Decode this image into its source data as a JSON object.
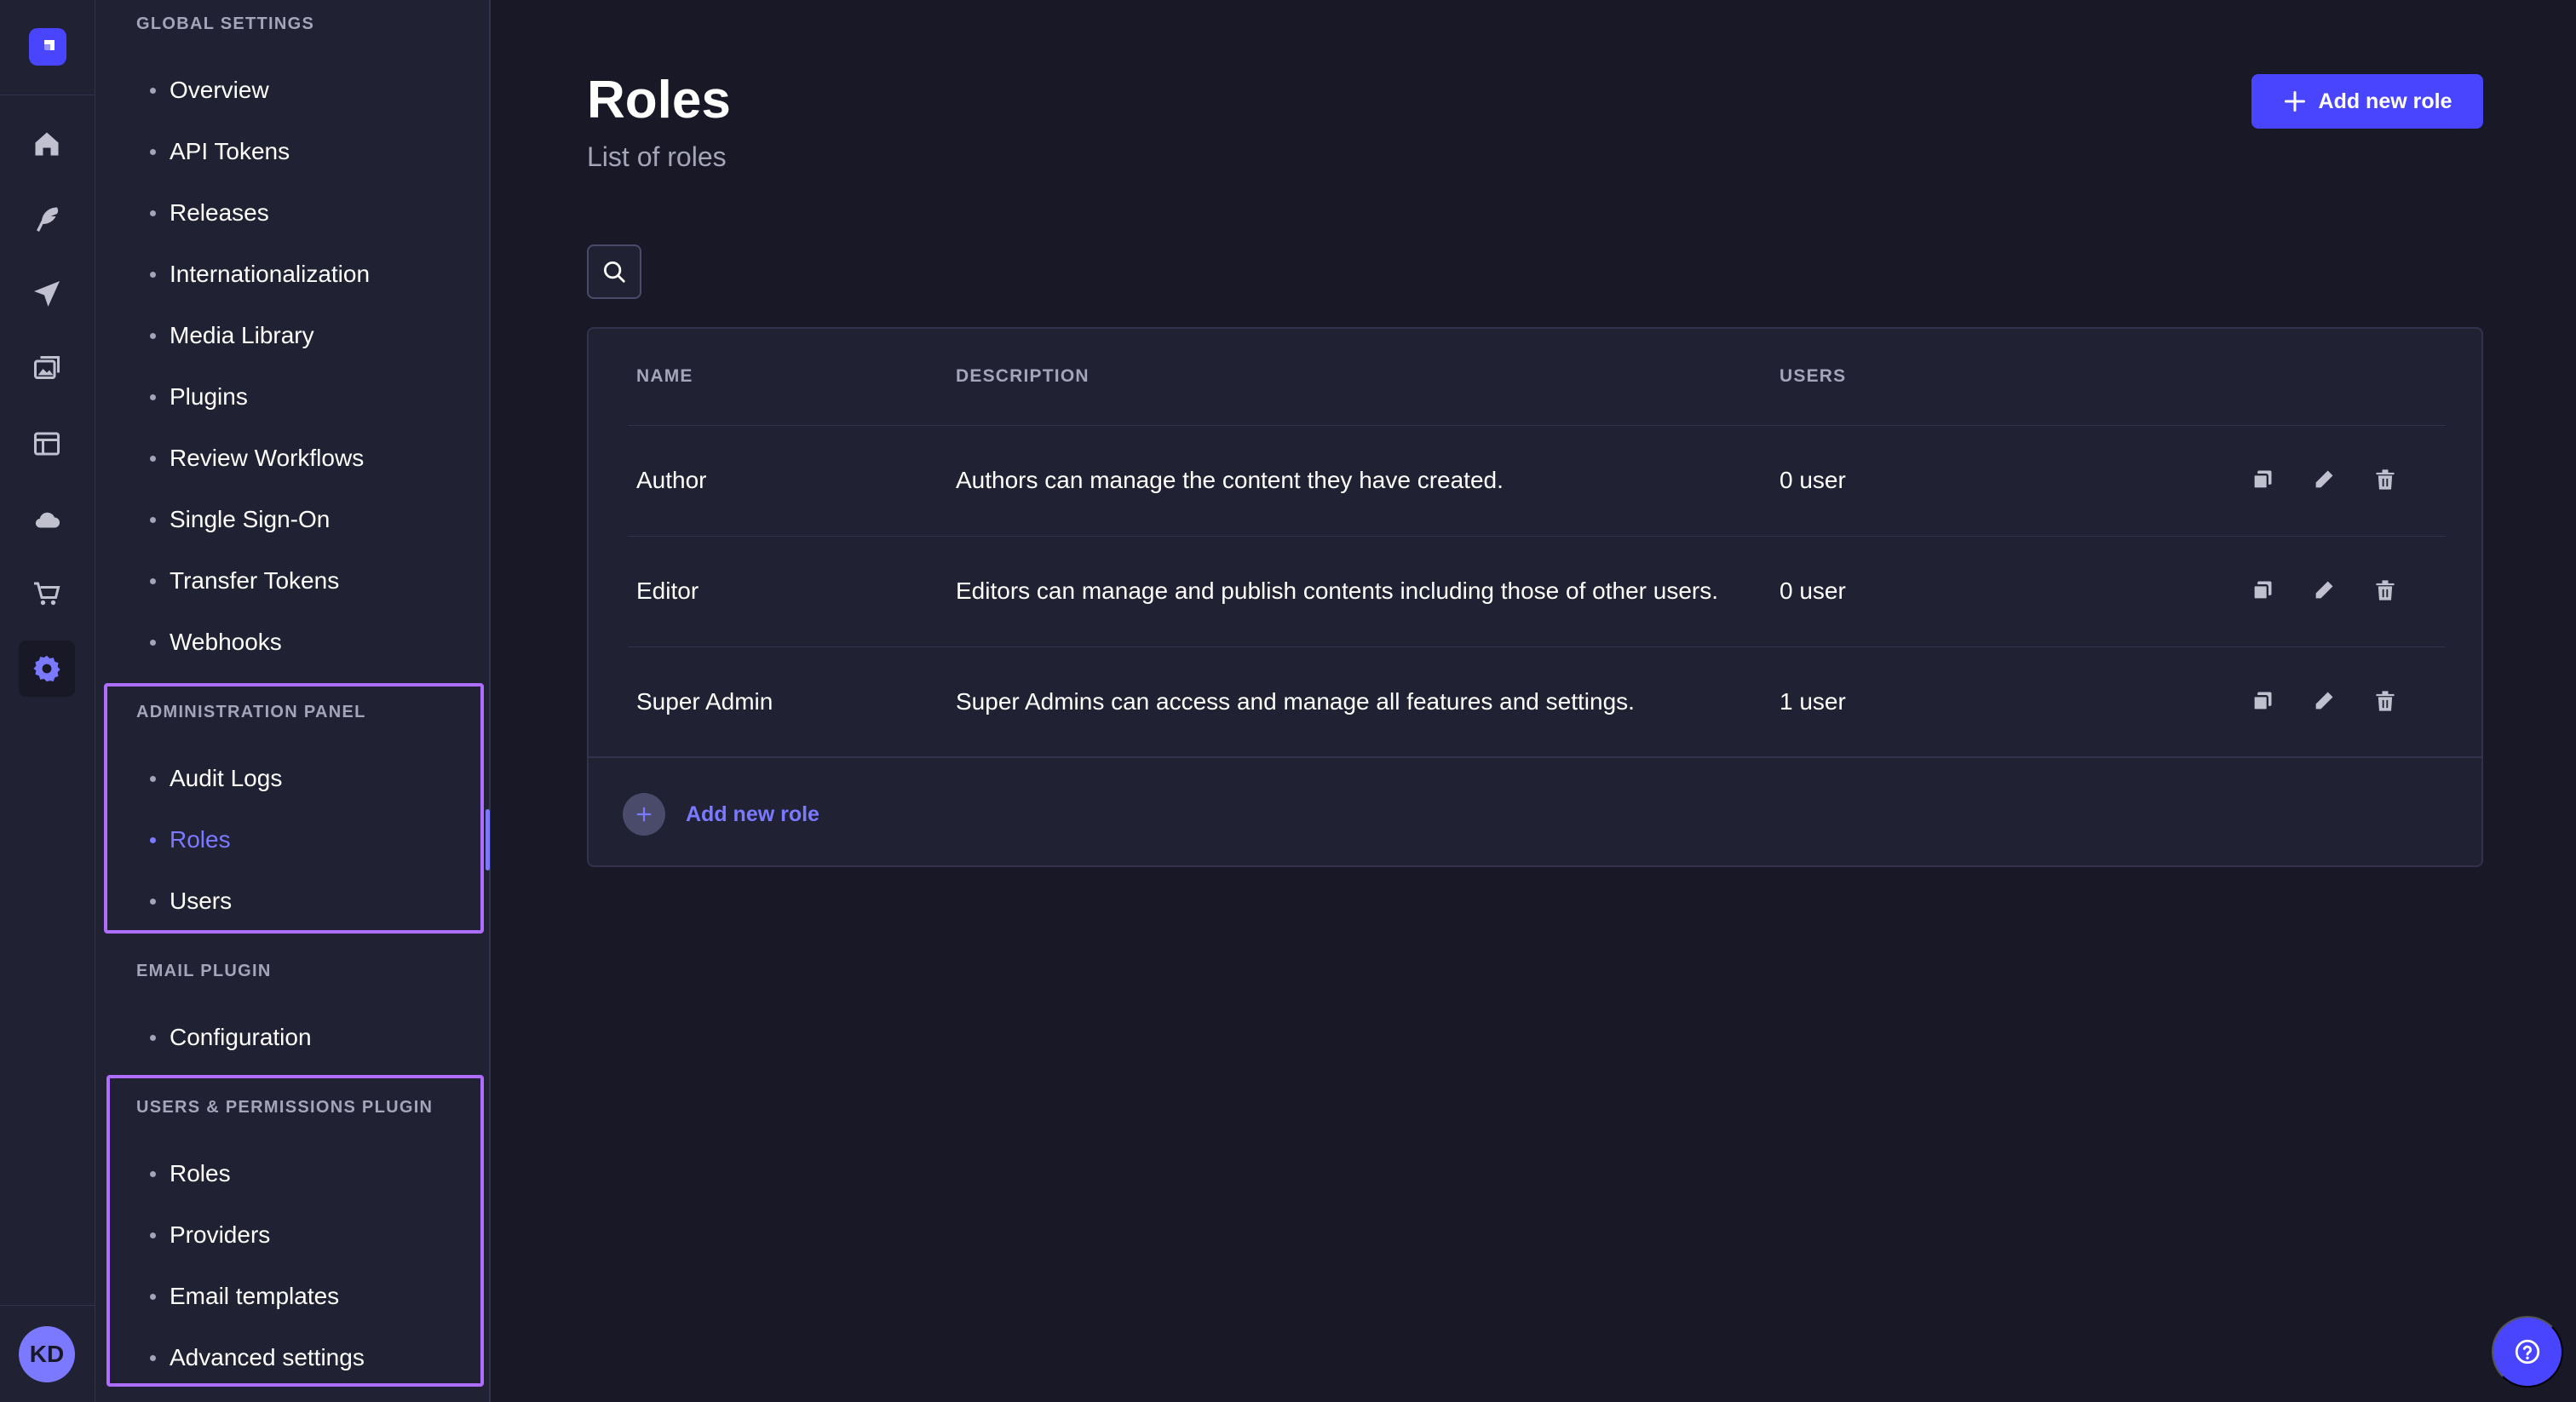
{
  "colors": {
    "background": "#181826",
    "surface": "#212134",
    "border": "#32324d",
    "primary": "#4945ff",
    "primary_light": "#7b79ff",
    "text": "#ffffff",
    "text_muted": "#a5a5ba",
    "highlight": "#ad6dff"
  },
  "rail": {
    "logo_icon": "strapi-logo-icon",
    "items": [
      {
        "icon": "home-icon",
        "active": false
      },
      {
        "icon": "feather-icon",
        "active": false
      },
      {
        "icon": "paper-plane-icon",
        "active": false
      },
      {
        "icon": "images-icon",
        "active": false
      },
      {
        "icon": "layout-icon",
        "active": false
      },
      {
        "icon": "cloud-icon",
        "active": false
      },
      {
        "icon": "cart-icon",
        "active": false
      },
      {
        "icon": "gear-icon",
        "active": true
      }
    ],
    "avatar_initials": "KD"
  },
  "subnav": {
    "global_settings": {
      "title": "GLOBAL SETTINGS",
      "items": [
        "Overview",
        "API Tokens",
        "Releases",
        "Internationalization",
        "Media Library",
        "Plugins",
        "Review Workflows",
        "Single Sign-On",
        "Transfer Tokens",
        "Webhooks"
      ]
    },
    "administration_panel": {
      "title": "ADMINISTRATION PANEL",
      "items": [
        "Audit Logs",
        "Roles",
        "Users"
      ],
      "active_item": "Roles"
    },
    "email_plugin": {
      "title": "EMAIL PLUGIN",
      "items": [
        "Configuration"
      ]
    },
    "users_permissions_plugin": {
      "title": "USERS & PERMISSIONS PLUGIN",
      "items": [
        "Roles",
        "Providers",
        "Email templates",
        "Advanced settings"
      ]
    }
  },
  "main": {
    "title": "Roles",
    "subtitle": "List of roles",
    "add_button_label": "Add new role",
    "table": {
      "headers": {
        "name": "NAME",
        "description": "DESCRIPTION",
        "users": "USERS"
      },
      "rows": [
        {
          "name": "Author",
          "description": "Authors can manage the content they have created.",
          "users": "0 user"
        },
        {
          "name": "Editor",
          "description": "Editors can manage and publish contents including those of other users.",
          "users": "0 user"
        },
        {
          "name": "Super Admin",
          "description": "Super Admins can access and manage all features and settings.",
          "users": "1 user"
        }
      ],
      "row_actions": [
        "duplicate-icon",
        "pencil-icon",
        "trash-icon"
      ],
      "footer_add_label": "Add new role"
    }
  },
  "help_icon": "help-circle-icon"
}
